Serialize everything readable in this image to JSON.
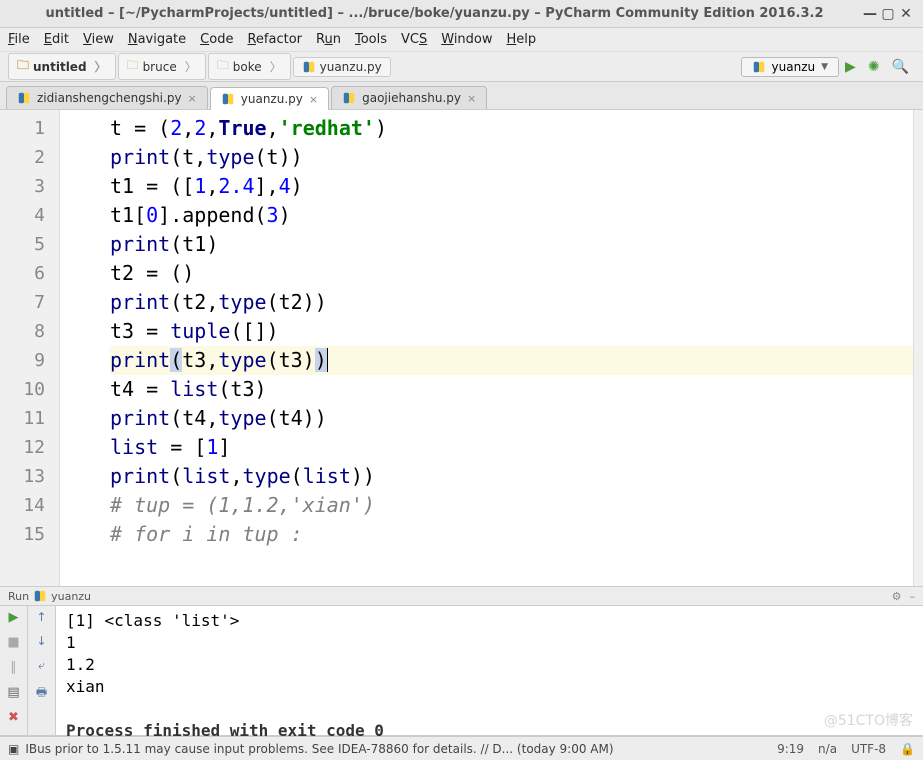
{
  "window": {
    "title": "untitled – [~/PycharmProjects/untitled] – .../bruce/boke/yuanzu.py – PyCharm Community Edition 2016.3.2",
    "minimize": "—",
    "maximize": "▢",
    "close": "✕"
  },
  "menu": [
    "File",
    "Edit",
    "View",
    "Navigate",
    "Code",
    "Refactor",
    "Run",
    "Tools",
    "VCS",
    "Window",
    "Help"
  ],
  "breadcrumbs": [
    {
      "label": "untitled",
      "type": "folder"
    },
    {
      "label": "bruce",
      "type": "folder"
    },
    {
      "label": "boke",
      "type": "folder"
    },
    {
      "label": "yuanzu.py",
      "type": "py"
    }
  ],
  "runconfig": {
    "label": "yuanzu"
  },
  "tabs": [
    {
      "label": "zidianshengchengshi.py",
      "active": false
    },
    {
      "label": "yuanzu.py",
      "active": true
    },
    {
      "label": "gaojiehanshu.py",
      "active": false
    }
  ],
  "code_lines": [
    {
      "n": "1",
      "tokens": [
        {
          "t": "t = (",
          "c": "plain"
        },
        {
          "t": "2",
          "c": "num"
        },
        {
          "t": ",",
          "c": "plain"
        },
        {
          "t": "2",
          "c": "num"
        },
        {
          "t": ",",
          "c": "plain"
        },
        {
          "t": "True",
          "c": "kw"
        },
        {
          "t": ",",
          "c": "plain"
        },
        {
          "t": "'redhat'",
          "c": "str"
        },
        {
          "t": ")",
          "c": "plain"
        }
      ]
    },
    {
      "n": "2",
      "tokens": [
        {
          "t": "print",
          "c": "bi"
        },
        {
          "t": "(t,",
          "c": "plain"
        },
        {
          "t": "type",
          "c": "bi"
        },
        {
          "t": "(t))",
          "c": "plain"
        }
      ]
    },
    {
      "n": "3",
      "tokens": [
        {
          "t": "t1 = ([",
          "c": "plain"
        },
        {
          "t": "1",
          "c": "num"
        },
        {
          "t": ",",
          "c": "plain"
        },
        {
          "t": "2.4",
          "c": "num"
        },
        {
          "t": "],",
          "c": "plain"
        },
        {
          "t": "4",
          "c": "num"
        },
        {
          "t": ")",
          "c": "plain"
        }
      ]
    },
    {
      "n": "4",
      "tokens": [
        {
          "t": "t1[",
          "c": "plain"
        },
        {
          "t": "0",
          "c": "num"
        },
        {
          "t": "].append(",
          "c": "plain"
        },
        {
          "t": "3",
          "c": "num"
        },
        {
          "t": ")",
          "c": "plain"
        }
      ]
    },
    {
      "n": "5",
      "tokens": [
        {
          "t": "print",
          "c": "bi"
        },
        {
          "t": "(t1)",
          "c": "plain"
        }
      ]
    },
    {
      "n": "6",
      "tokens": [
        {
          "t": "t2 = ()",
          "c": "plain"
        }
      ]
    },
    {
      "n": "7",
      "tokens": [
        {
          "t": "print",
          "c": "bi"
        },
        {
          "t": "(t2,",
          "c": "plain"
        },
        {
          "t": "type",
          "c": "bi"
        },
        {
          "t": "(t2))",
          "c": "plain"
        }
      ]
    },
    {
      "n": "8",
      "tokens": [
        {
          "t": "t3 = ",
          "c": "plain"
        },
        {
          "t": "tuple",
          "c": "bi"
        },
        {
          "t": "([])",
          "c": "plain"
        }
      ]
    },
    {
      "n": "9",
      "hl": true,
      "tokens": [
        {
          "t": "print",
          "c": "bi"
        },
        {
          "t": "(",
          "c": "brhl"
        },
        {
          "t": "t3,",
          "c": "plain"
        },
        {
          "t": "type",
          "c": "bi"
        },
        {
          "t": "(t3)",
          "c": "plain"
        },
        {
          "t": ")",
          "c": "brhl"
        },
        {
          "t": "",
          "c": "caret"
        }
      ]
    },
    {
      "n": "10",
      "tokens": [
        {
          "t": "t4 = ",
          "c": "plain"
        },
        {
          "t": "list",
          "c": "bi"
        },
        {
          "t": "(t3)",
          "c": "plain"
        }
      ]
    },
    {
      "n": "11",
      "tokens": [
        {
          "t": "print",
          "c": "bi"
        },
        {
          "t": "(t4,",
          "c": "plain"
        },
        {
          "t": "type",
          "c": "bi"
        },
        {
          "t": "(t4))",
          "c": "plain"
        }
      ]
    },
    {
      "n": "12",
      "tokens": [
        {
          "t": "list",
          "c": "bi"
        },
        {
          "t": " = [",
          "c": "plain"
        },
        {
          "t": "1",
          "c": "num"
        },
        {
          "t": "]",
          "c": "plain"
        }
      ]
    },
    {
      "n": "13",
      "tokens": [
        {
          "t": "print",
          "c": "bi"
        },
        {
          "t": "(",
          "c": "plain"
        },
        {
          "t": "list",
          "c": "bi"
        },
        {
          "t": ",",
          "c": "plain"
        },
        {
          "t": "type",
          "c": "bi"
        },
        {
          "t": "(",
          "c": "plain"
        },
        {
          "t": "list",
          "c": "bi"
        },
        {
          "t": "))",
          "c": "plain"
        }
      ]
    },
    {
      "n": "14",
      "tokens": [
        {
          "t": "# tup = (1,1.2,'xian')",
          "c": "cmt"
        }
      ]
    },
    {
      "n": "15",
      "tokens": [
        {
          "t": "# for i in tup :",
          "c": "cmt"
        }
      ]
    }
  ],
  "run_panel": {
    "title_prefix": "Run ",
    "title_name": "yuanzu",
    "output": [
      "[1] <class 'list'>",
      "1",
      "1.2",
      "xian",
      "",
      "Process finished with exit code 0"
    ]
  },
  "statusbar": {
    "left": "IBus prior to 1.5.11 may cause input problems. See IDEA-78860 for details. // D... (today 9:00 AM)",
    "pos": "9:19",
    "na": "n/a",
    "enc": "UTF-8",
    "lock": "🔒"
  },
  "watermark": "@51CTO博客"
}
